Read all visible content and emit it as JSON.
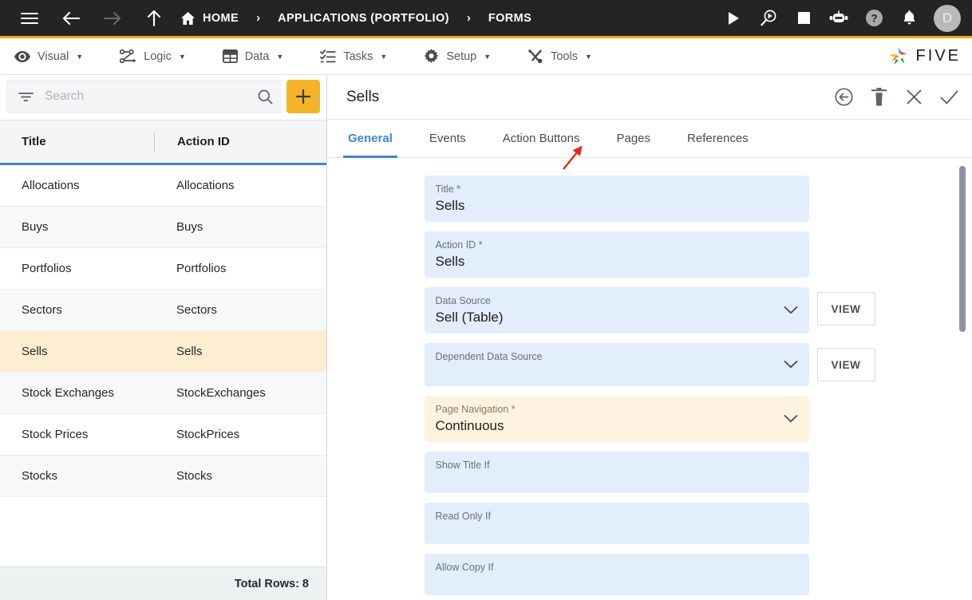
{
  "topbar": {
    "menu_icon": "hamburger-icon",
    "back_icon": "arrow-left-icon",
    "forward_icon": "arrow-right-icon",
    "up_icon": "arrow-up-icon",
    "breadcrumb": [
      {
        "label": "HOME",
        "icon": "home-icon"
      },
      {
        "label": "APPLICATIONS (PORTFOLIO)",
        "icon": ""
      },
      {
        "label": "FORMS",
        "icon": ""
      }
    ],
    "separator": "›",
    "actions": [
      {
        "name": "run-icon",
        "title": "Run"
      },
      {
        "name": "debug-icon",
        "title": "Debug"
      },
      {
        "name": "stop-icon",
        "title": "Stop"
      },
      {
        "name": "chatbot-icon",
        "title": "Assistant"
      },
      {
        "name": "help-icon",
        "title": "Help"
      },
      {
        "name": "notifications-icon",
        "title": "Notifications"
      }
    ],
    "avatar_initial": "D",
    "accent_color": "#f0ad20",
    "background": "#242424"
  },
  "menubar": {
    "items": [
      {
        "label": "Visual",
        "icon": "eye-icon"
      },
      {
        "label": "Logic",
        "icon": "logic-nodes-icon"
      },
      {
        "label": "Data",
        "icon": "table-grid-icon"
      },
      {
        "label": "Tasks",
        "icon": "checklist-icon"
      },
      {
        "label": "Setup",
        "icon": "gear-icon"
      },
      {
        "label": "Tools",
        "icon": "tools-icon"
      }
    ],
    "caret": "▼",
    "brand": "FIVE"
  },
  "sidebar": {
    "search": {
      "placeholder": "Search",
      "value": "",
      "filter_icon": "filter-icon",
      "search_icon": "search-icon"
    },
    "add_button": {
      "label": "+",
      "color": "#f5b428"
    },
    "table": {
      "columns": [
        "Title",
        "Action ID"
      ],
      "rows": [
        {
          "title": "Allocations",
          "action_id": "Allocations",
          "selected": false
        },
        {
          "title": "Buys",
          "action_id": "Buys",
          "selected": false
        },
        {
          "title": "Portfolios",
          "action_id": "Portfolios",
          "selected": false
        },
        {
          "title": "Sectors",
          "action_id": "Sectors",
          "selected": false
        },
        {
          "title": "Sells",
          "action_id": "Sells",
          "selected": true
        },
        {
          "title": "Stock Exchanges",
          "action_id": "StockExchanges",
          "selected": false
        },
        {
          "title": "Stock Prices",
          "action_id": "StockPrices",
          "selected": false
        },
        {
          "title": "Stocks",
          "action_id": "Stocks",
          "selected": false
        }
      ],
      "footer": "Total Rows: 8",
      "header_underline_color": "#4285d8",
      "selected_row_color": "#fdeed2"
    }
  },
  "detail": {
    "title": "Sells",
    "header_actions": [
      {
        "name": "undo-icon",
        "title": "Undo"
      },
      {
        "name": "delete-icon",
        "title": "Delete"
      },
      {
        "name": "close-icon",
        "title": "Close"
      },
      {
        "name": "save-icon",
        "title": "Save"
      }
    ],
    "tabs": [
      {
        "label": "General",
        "active": true
      },
      {
        "label": "Events",
        "active": false
      },
      {
        "label": "Action Buttons",
        "active": false
      },
      {
        "label": "Pages",
        "active": false
      },
      {
        "label": "References",
        "active": false
      }
    ],
    "active_tab_color": "#4285d8",
    "fields": [
      {
        "label": "Title *",
        "value": "Sells",
        "type": "text",
        "view": false,
        "highlight": false
      },
      {
        "label": "Action ID *",
        "value": "Sells",
        "type": "text",
        "view": false,
        "highlight": false
      },
      {
        "label": "Data Source",
        "value": "Sell (Table)",
        "type": "select",
        "view": true,
        "view_label": "VIEW",
        "highlight": false
      },
      {
        "label": "Dependent Data Source",
        "value": "",
        "type": "select",
        "view": true,
        "view_label": "VIEW",
        "highlight": false
      },
      {
        "label": "Page Navigation *",
        "value": "Continuous",
        "type": "select",
        "view": false,
        "highlight": true
      },
      {
        "label": "Show Title If",
        "value": "",
        "type": "text",
        "view": false,
        "highlight": false
      },
      {
        "label": "Read Only If",
        "value": "",
        "type": "text",
        "view": false,
        "highlight": false
      },
      {
        "label": "Allow Copy If",
        "value": "",
        "type": "text",
        "view": false,
        "highlight": false
      }
    ]
  },
  "annotation": {
    "arrow_color": "#e8271e",
    "points_to": "Pages"
  }
}
